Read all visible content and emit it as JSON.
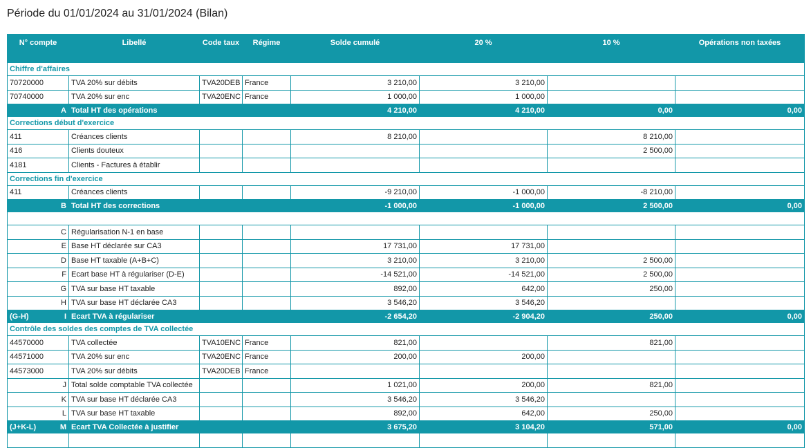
{
  "title": "Période du 01/01/2024 au 31/01/2024 (Bilan)",
  "headers": {
    "compte": "N° compte",
    "libelle": "Libellé",
    "code_taux": "Code taux",
    "regime": "Régime",
    "solde": "Solde cumulé",
    "t20": "20 %",
    "t10": "10 %",
    "non_taxees": "Opérations non taxées"
  },
  "sec_ca": {
    "title": "Chiffre d'affaires",
    "rows": [
      {
        "compte": "70720000",
        "libelle": "TVA 20% sur débits",
        "code": "TVA20DEB",
        "regime": "France",
        "solde": "3 210,00",
        "t20": "3 210,00",
        "t10": "",
        "nt": ""
      },
      {
        "compte": "70740000",
        "libelle": "TVA 20% sur enc",
        "code": "TVA20ENC",
        "regime": "France",
        "solde": "1 000,00",
        "t20": "1 000,00",
        "t10": "",
        "nt": ""
      }
    ]
  },
  "total_a": {
    "pre": "",
    "letter": "A",
    "label": "Total HT des opérations",
    "solde": "4 210,00",
    "t20": "4 210,00",
    "t10": "0,00",
    "nt": "0,00"
  },
  "sec_deb": {
    "title": "Corrections début d'exercice",
    "rows": [
      {
        "compte": "411",
        "libelle": "Créances clients",
        "code": "",
        "regime": "",
        "solde": "8 210,00",
        "t20": "",
        "t10": "8 210,00",
        "nt": ""
      },
      {
        "compte": "416",
        "libelle": "Clients douteux",
        "code": "",
        "regime": "",
        "solde": "",
        "t20": "",
        "t10": "2 500,00",
        "nt": ""
      },
      {
        "compte": "4181",
        "libelle": "Clients - Factures à établir",
        "code": "",
        "regime": "",
        "solde": "",
        "t20": "",
        "t10": "",
        "nt": ""
      }
    ]
  },
  "sec_fin": {
    "title": "Corrections fin d'exercice",
    "rows": [
      {
        "compte": "411",
        "libelle": "Créances clients",
        "code": "",
        "regime": "",
        "solde": "-9 210,00",
        "t20": "-1 000,00",
        "t10": "-8 210,00",
        "nt": ""
      }
    ]
  },
  "total_b": {
    "pre": "",
    "letter": "B",
    "label": "Total HT des corrections",
    "solde": "-1 000,00",
    "t20": "-1 000,00",
    "t10": "2 500,00",
    "nt": "0,00"
  },
  "calc": {
    "rows": [
      {
        "letter": "C",
        "libelle": "Régularisation N-1 en base",
        "solde": "",
        "t20": "",
        "t10": "",
        "nt": ""
      },
      {
        "letter": "E",
        "libelle": "Base HT déclarée sur CA3",
        "solde": "17 731,00",
        "t20": "17 731,00",
        "t10": "",
        "nt": ""
      },
      {
        "letter": "D",
        "libelle": "Base HT taxable (A+B+C)",
        "solde": "3 210,00",
        "t20": "3 210,00",
        "t10": "2 500,00",
        "nt": ""
      },
      {
        "letter": "F",
        "libelle": "Ecart base HT à régulariser (D-E)",
        "solde": "-14 521,00",
        "t20": "-14 521,00",
        "t10": "2 500,00",
        "nt": ""
      },
      {
        "letter": "G",
        "libelle": "TVA sur base HT taxable",
        "solde": "892,00",
        "t20": "642,00",
        "t10": "250,00",
        "nt": ""
      },
      {
        "letter": "H",
        "libelle": "TVA sur base HT déclarée CA3",
        "solde": "3 546,20",
        "t20": "3 546,20",
        "t10": "",
        "nt": ""
      }
    ]
  },
  "total_i": {
    "pre": "(G-H)",
    "letter": "I",
    "label": "Ecart TVA à régulariser",
    "solde": "-2 654,20",
    "t20": "-2 904,20",
    "t10": "250,00",
    "nt": "0,00"
  },
  "sec_ctrl": {
    "title": "Contrôle des soldes des comptes de TVA collectée",
    "rows": [
      {
        "compte": "44570000",
        "libelle": "TVA collectée",
        "code": "TVA10ENC",
        "regime": "France",
        "solde": "821,00",
        "t20": "",
        "t10": "821,00",
        "nt": ""
      },
      {
        "compte": "44571000",
        "libelle": "TVA 20% sur enc",
        "code": "TVA20ENC",
        "regime": "France",
        "solde": "200,00",
        "t20": "200,00",
        "t10": "",
        "nt": ""
      },
      {
        "compte": "44573000",
        "libelle": "TVA 20% sur débits",
        "code": "TVA20DEB",
        "regime": "France",
        "solde": "",
        "t20": "",
        "t10": "",
        "nt": ""
      }
    ]
  },
  "calc2": {
    "rows": [
      {
        "letter": "J",
        "libelle": "Total solde comptable TVA collectée",
        "solde": "1 021,00",
        "t20": "200,00",
        "t10": "821,00",
        "nt": ""
      },
      {
        "letter": "K",
        "libelle": "TVA sur base HT déclarée CA3",
        "solde": "3 546,20",
        "t20": "3 546,20",
        "t10": "",
        "nt": ""
      },
      {
        "letter": "L",
        "libelle": "TVA sur base HT taxable",
        "solde": "892,00",
        "t20": "642,00",
        "t10": "250,00",
        "nt": ""
      }
    ]
  },
  "total_m": {
    "pre": "(J+K-L)",
    "letter": "M",
    "label": "Ecart TVA Collectée à justifier",
    "solde": "3 675,20",
    "t20": "3 104,20",
    "t10": "571,00",
    "nt": "0,00"
  },
  "colors": {
    "accent": "#1297a8"
  }
}
